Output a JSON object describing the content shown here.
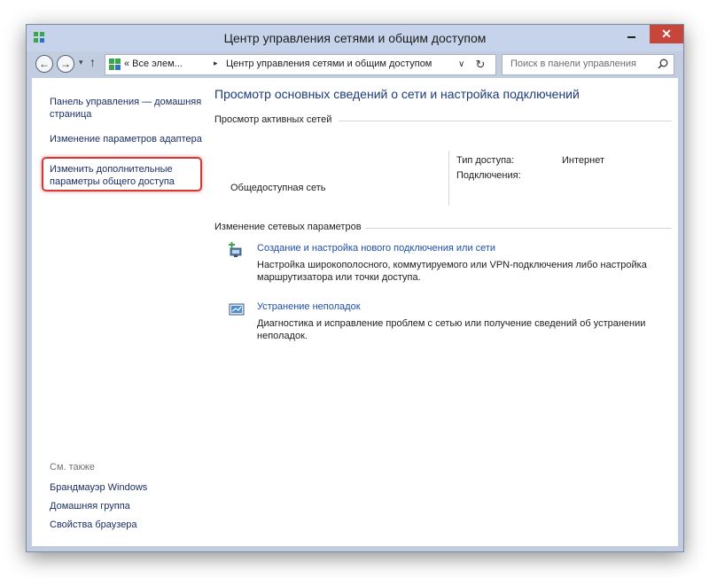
{
  "window": {
    "title": "Центр управления сетями и общим доступом",
    "close_glyph": "✕"
  },
  "nav": {
    "back_glyph": "←",
    "forward_glyph": "→",
    "dropdown_glyph": "▾",
    "up_glyph": "↑"
  },
  "address": {
    "crumb_root": "« Все элем...",
    "crumb_separator": "▸",
    "crumb_current": "Центр управления сетями и общим доступом",
    "dropdown_glyph": "∨",
    "refresh_glyph": "↻"
  },
  "search": {
    "placeholder": "Поиск в панели управления"
  },
  "sidebar": {
    "home_link": "Панель управления — домашняя страница",
    "adapter_link": "Изменение параметров адаптера",
    "sharing_link": "Изменить дополнительные параметры общего доступа",
    "see_also_title": "См. также",
    "see_also": [
      "Брандмауэр Windows",
      "Домашняя группа",
      "Свойства браузера"
    ]
  },
  "main": {
    "title": "Просмотр основных сведений о сети и настройка подключений",
    "active_networks_title": "Просмотр активных сетей",
    "network_name": "Общедоступная сеть",
    "access_type_label": "Тип доступа:",
    "access_type_value": "Интернет",
    "connections_label": "Подключения:",
    "change_settings_title": "Изменение сетевых параметров",
    "tasks": [
      {
        "link": "Создание и настройка нового подключения или сети",
        "desc": "Настройка широкополосного, коммутируемого или VPN-подключения либо настройка маршрутизатора или точки доступа."
      },
      {
        "link": "Устранение неполадок",
        "desc": "Диагностика и исправление проблем с сетью или получение сведений об устранении неполадок."
      }
    ]
  },
  "colors": {
    "titlebar": "#c6d3ea",
    "close_button": "#c7463b",
    "link": "#1d4fa8",
    "heading": "#1c3a7c",
    "highlight": "#d33a37"
  }
}
